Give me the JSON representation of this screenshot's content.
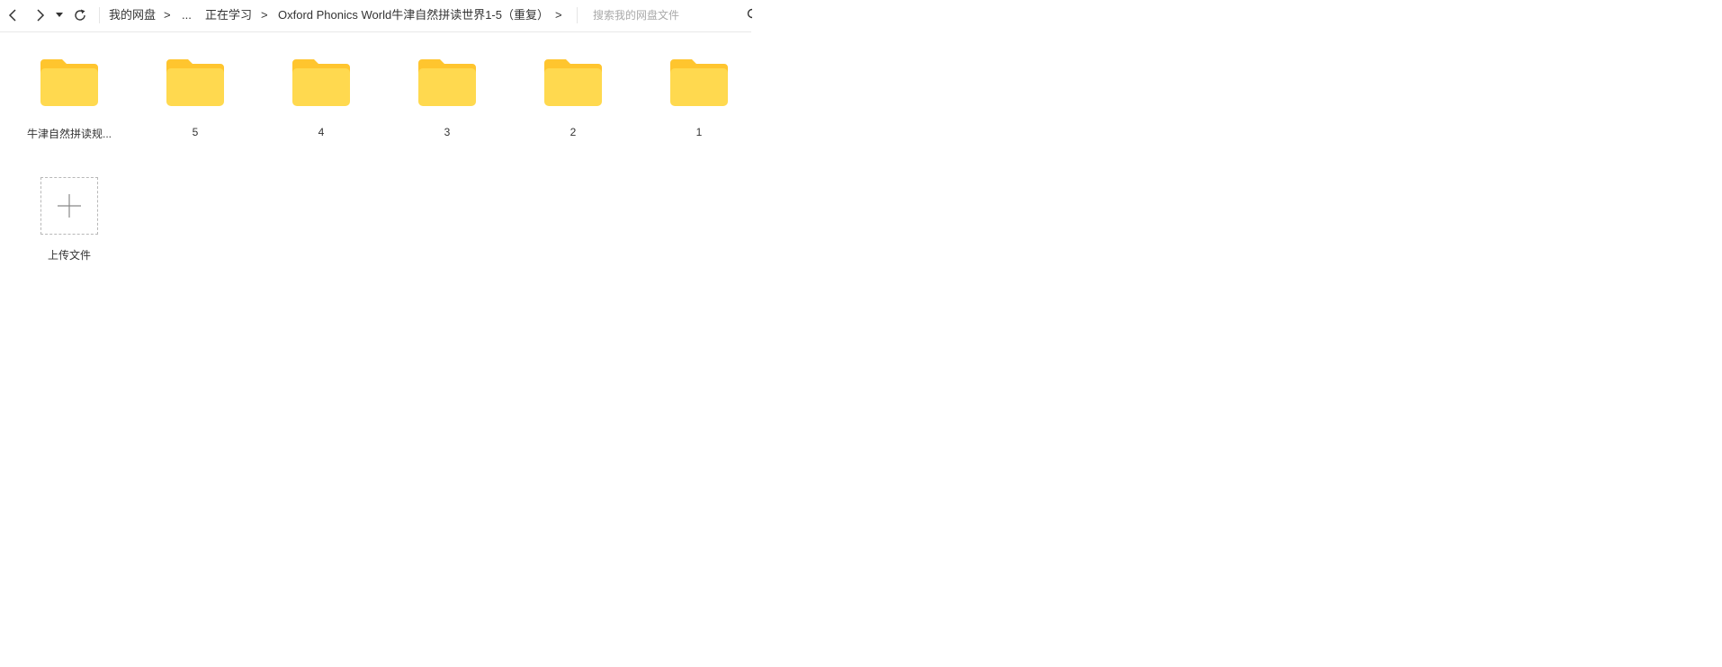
{
  "toolbar": {
    "back_icon": "chevron-left-icon",
    "forward_icon": "chevron-right-icon",
    "history_icon": "caret-down-icon",
    "refresh_icon": "refresh-icon",
    "search_placeholder": "搜索我的网盘文件"
  },
  "breadcrumb": {
    "items": [
      "我的网盘",
      "...",
      "正在学习",
      "Oxford Phonics World牛津自然拼读世界1-5（重复）"
    ],
    "separator": ">"
  },
  "files": [
    {
      "name": "牛津自然拼读规...",
      "type": "folder"
    },
    {
      "name": "5",
      "type": "folder"
    },
    {
      "name": "4",
      "type": "folder"
    },
    {
      "name": "3",
      "type": "folder"
    },
    {
      "name": "2",
      "type": "folder"
    },
    {
      "name": "1",
      "type": "folder"
    }
  ],
  "upload": {
    "label": "上传文件",
    "icon": "plus-icon"
  },
  "colors": {
    "folder_back": "#FFCB2E",
    "folder_front": "#FFD94F"
  }
}
